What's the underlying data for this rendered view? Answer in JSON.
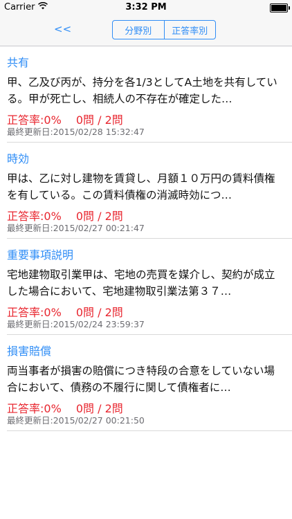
{
  "status_bar": {
    "carrier": "Carrier",
    "time": "3:32 PM"
  },
  "nav": {
    "back_label": "<<",
    "segments": [
      "分野別",
      "正答率別"
    ],
    "accent_color": "#2f8df6"
  },
  "items": [
    {
      "title": "共有",
      "text": "甲、乙及び丙が、持分を各1/3としてA土地を共有している。甲が死亡し、相続人の不存在が確定した…",
      "score": "正答率:0%　 0問 / 2問",
      "updated": "最終更新日:2015/02/28 15:32:47"
    },
    {
      "title": "時効",
      "text": "甲は、乙に対し建物を賃貸し、月額１０万円の賃料債権を有している。この賃料債権の消滅時効につ…",
      "score": "正答率:0%　 0問 / 2問",
      "updated": "最終更新日:2015/02/27 00:21:47"
    },
    {
      "title": "重要事項説明",
      "text": "宅地建物取引業甲は、宅地の売買を媒介し、契約が成立した場合において、宅地建物取引業法第３７…",
      "score": "正答率:0%　 0問 / 2問",
      "updated": "最終更新日:2015/02/24 23:59:37"
    },
    {
      "title": "損害賠償",
      "text": "両当事者が損害の賠償につき特段の合意をしていない場合において、債務の不履行に関して債権者に…",
      "score": "正答率:0%　 0問 / 2問",
      "updated": "最終更新日:2015/02/27 00:21:50"
    }
  ]
}
